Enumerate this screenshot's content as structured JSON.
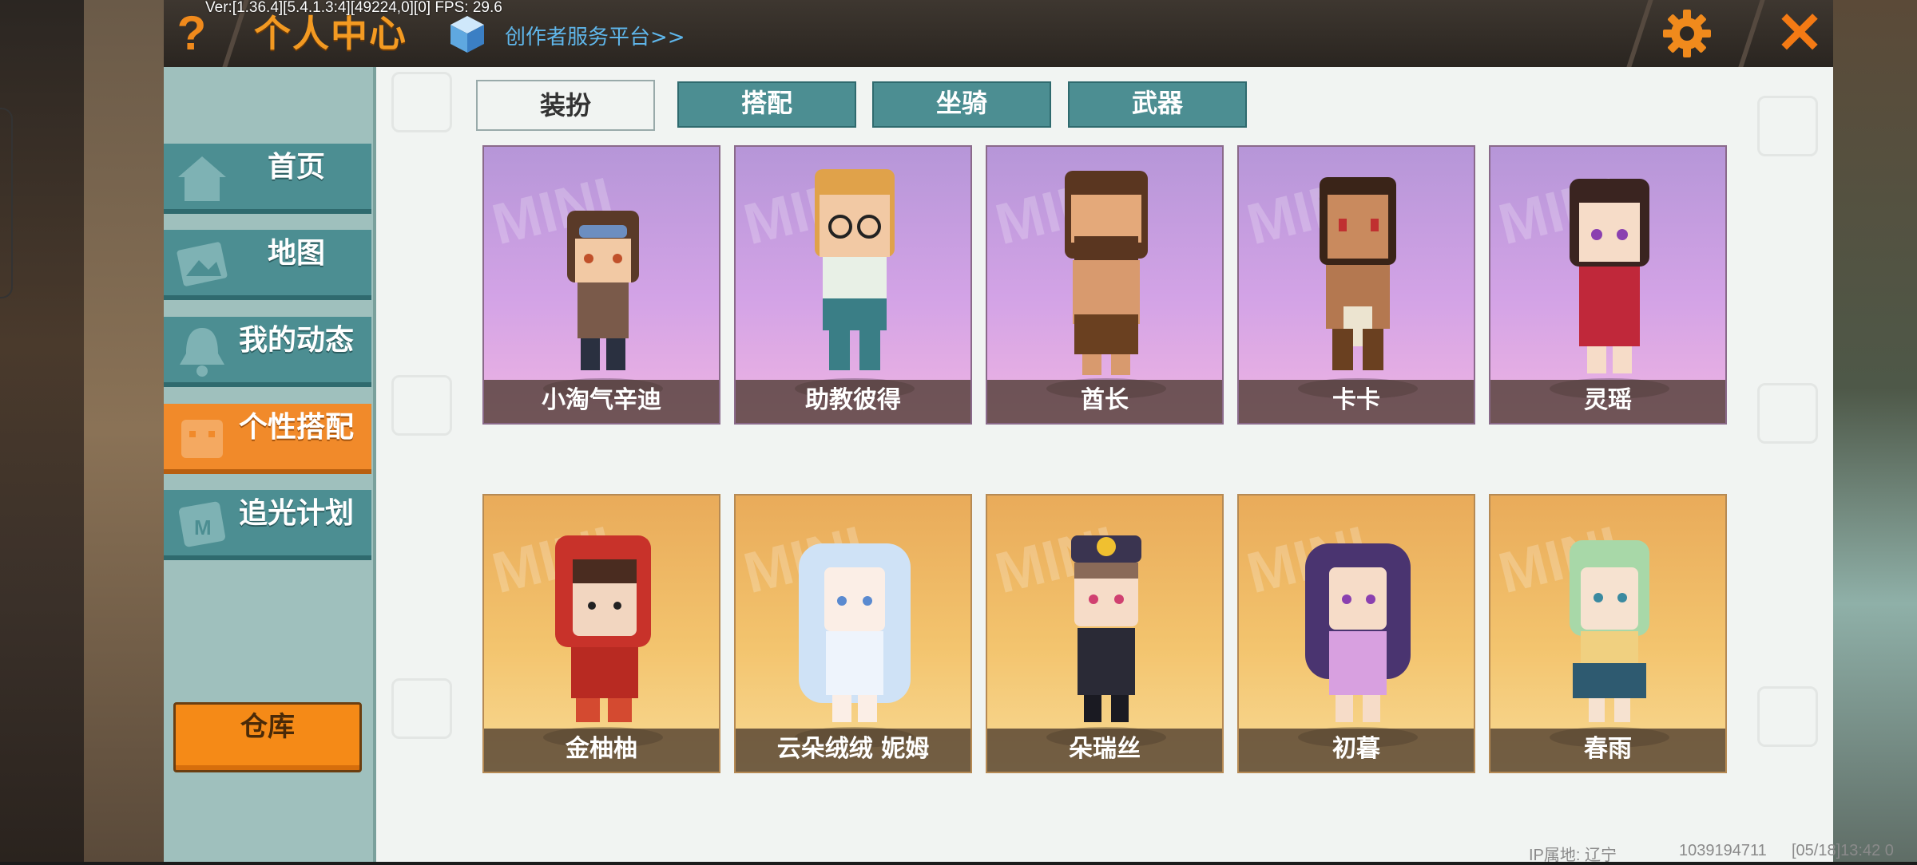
{
  "version_info": "Ver:[1.36.4][5.4.1.3:4][49224,0][0] FPS: 29.6",
  "header": {
    "help_label": "?",
    "title": "个人中心",
    "creator_link": "创作者服务平台>>",
    "close_label": "✕",
    "icons": [
      "help-icon",
      "cube-icon",
      "gear-icon",
      "close-icon"
    ],
    "accent_color": "#f08a1c"
  },
  "sidebar": {
    "items": [
      {
        "label": "首页",
        "icon": "home-icon",
        "active": false
      },
      {
        "label": "地图",
        "icon": "map-icon",
        "active": false
      },
      {
        "label": "我的动态",
        "icon": "bell-icon",
        "active": false
      },
      {
        "label": "个性搭配",
        "icon": "outfit-icon",
        "active": true
      },
      {
        "label": "追光计划",
        "icon": "star-plan-icon",
        "active": false
      }
    ],
    "store_label": "仓库"
  },
  "tabs": [
    {
      "label": "装扮",
      "active": true
    },
    {
      "label": "搭配",
      "active": false
    },
    {
      "label": "坐骑",
      "active": false
    },
    {
      "label": "武器",
      "active": false
    }
  ],
  "skins": {
    "row1": [
      {
        "name": "小淘气辛迪"
      },
      {
        "name": "助教彼得"
      },
      {
        "name": "酋长"
      },
      {
        "name": "卡卡"
      },
      {
        "name": "灵瑶"
      }
    ],
    "row2": [
      {
        "name": "金柚柚"
      },
      {
        "name": "云朵绒绒 妮姆"
      },
      {
        "name": "朵瑞丝"
      },
      {
        "name": "初暮"
      },
      {
        "name": "春雨"
      }
    ],
    "card_watermark": "MINI"
  },
  "footer": {
    "ip_location": "IP属地: 辽宁",
    "user_id": "1039194711",
    "timestamp": "[05/18]13:42 0"
  },
  "colors": {
    "teal": "#4c8e92",
    "orange": "#f18a2a",
    "purple_card": "#c8a0e0",
    "gold_card": "#f3c46e"
  }
}
